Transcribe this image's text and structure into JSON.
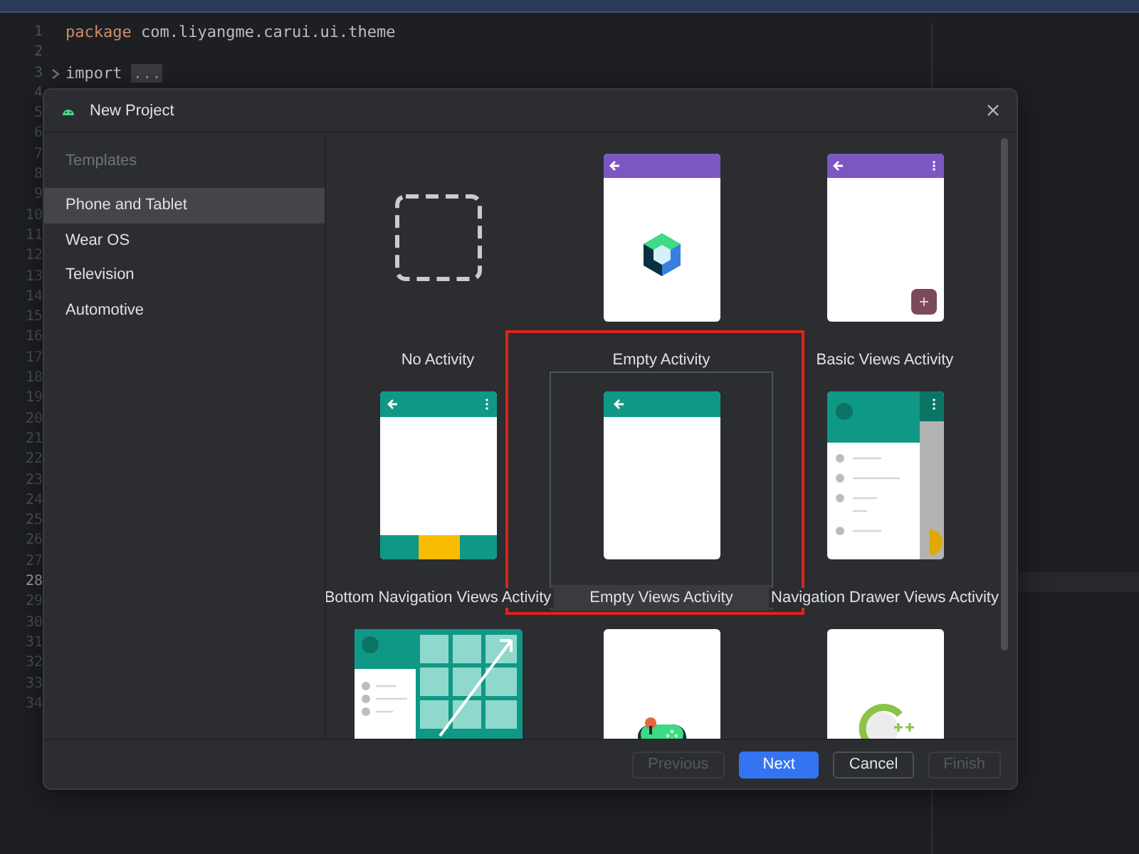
{
  "editor": {
    "lines": [
      {
        "number": "1",
        "tokens": [
          {
            "kind": "keyword",
            "text": "package"
          },
          {
            "kind": "plain",
            "text": " com.liyangme.carui.ui.theme"
          }
        ]
      },
      {
        "number": "2"
      },
      {
        "number": "3",
        "folded": true,
        "tokens": [
          {
            "kind": "plain",
            "text": "import "
          },
          {
            "kind": "fold",
            "text": "..."
          }
        ]
      },
      {
        "number": "4"
      },
      {
        "number": "5"
      },
      {
        "number": "6"
      },
      {
        "number": "7"
      },
      {
        "number": "8"
      },
      {
        "number": "9"
      },
      {
        "number": "10"
      },
      {
        "number": "11"
      },
      {
        "number": "12"
      },
      {
        "number": "13"
      },
      {
        "number": "14"
      },
      {
        "number": "15"
      },
      {
        "number": "16"
      },
      {
        "number": "17"
      },
      {
        "number": "18"
      },
      {
        "number": "19"
      },
      {
        "number": "20"
      },
      {
        "number": "21"
      },
      {
        "number": "22"
      },
      {
        "number": "23"
      },
      {
        "number": "24"
      },
      {
        "number": "25"
      },
      {
        "number": "26"
      },
      {
        "number": "27"
      },
      {
        "number": "28",
        "current": true
      },
      {
        "number": "29"
      },
      {
        "number": "30"
      },
      {
        "number": "31"
      },
      {
        "number": "32"
      },
      {
        "number": "33"
      },
      {
        "number": "34"
      }
    ]
  },
  "dialog": {
    "title": "New Project",
    "sidebar": {
      "header": "Templates",
      "items": [
        {
          "label": "Phone and Tablet",
          "selected": true
        },
        {
          "label": "Wear OS",
          "selected": false
        },
        {
          "label": "Television",
          "selected": false
        },
        {
          "label": "Automotive",
          "selected": false
        }
      ]
    },
    "templates": [
      {
        "kind": "none",
        "label": "No Activity",
        "selected": false
      },
      {
        "kind": "compose",
        "label": "Empty Activity",
        "selected": false
      },
      {
        "kind": "basic",
        "label": "Basic Views Activity",
        "selected": false
      },
      {
        "kind": "bottom-nav",
        "label": "Bottom Navigation Views Activity",
        "selected": false
      },
      {
        "kind": "empty-views",
        "label": "Empty Views Activity",
        "selected": true
      },
      {
        "kind": "nav-drawer",
        "label": "Navigation Drawer Views Activity",
        "selected": false
      },
      {
        "kind": "responsive",
        "selected": false
      },
      {
        "kind": "game",
        "selected": false
      },
      {
        "kind": "cpp",
        "selected": false
      }
    ],
    "buttons": [
      {
        "label": "Previous",
        "kind": "secondary",
        "disabled": true
      },
      {
        "label": "Next",
        "kind": "primary",
        "disabled": false
      },
      {
        "label": "Cancel",
        "kind": "secondary",
        "disabled": false
      },
      {
        "label": "Finish",
        "kind": "secondary",
        "disabled": true
      }
    ]
  }
}
